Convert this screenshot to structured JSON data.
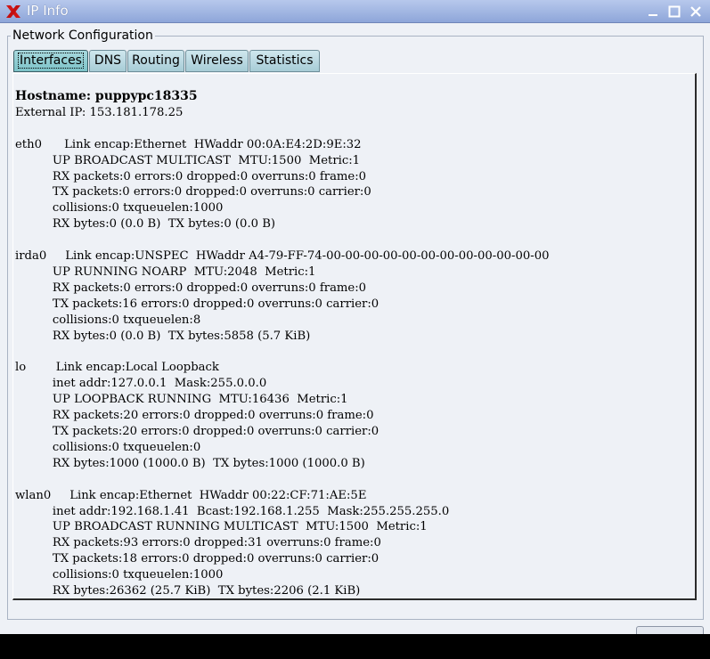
{
  "window": {
    "title": "IP Info",
    "controls": {
      "minimize": "minimize-icon",
      "maximize": "maximize-icon",
      "close": "close-icon"
    }
  },
  "frame": {
    "label": "Network Configuration"
  },
  "tabs": [
    {
      "label": "Interfaces",
      "active": true
    },
    {
      "label": "DNS",
      "active": false
    },
    {
      "label": "Routing",
      "active": false
    },
    {
      "label": "Wireless",
      "active": false
    },
    {
      "label": "Statistics",
      "active": false
    }
  ],
  "content": {
    "hostname_line": "Hostname: puppypc18335",
    "external_ip_line": "External IP: 153.181.178.25",
    "interfaces": [
      {
        "name": "eth0",
        "lines": [
          "Link encap:Ethernet  HWaddr 00:0A:E4:2D:9E:32",
          "UP BROADCAST MULTICAST  MTU:1500  Metric:1",
          "RX packets:0 errors:0 dropped:0 overruns:0 frame:0",
          "TX packets:0 errors:0 dropped:0 overruns:0 carrier:0",
          "collisions:0 txqueuelen:1000",
          "RX bytes:0 (0.0 B)  TX bytes:0 (0.0 B)"
        ]
      },
      {
        "name": "irda0",
        "lines": [
          "Link encap:UNSPEC  HWaddr A4-79-FF-74-00-00-00-00-00-00-00-00-00-00-00-00",
          "UP RUNNING NOARP  MTU:2048  Metric:1",
          "RX packets:0 errors:0 dropped:0 overruns:0 frame:0",
          "TX packets:16 errors:0 dropped:0 overruns:0 carrier:0",
          "collisions:0 txqueuelen:8",
          "RX bytes:0 (0.0 B)  TX bytes:5858 (5.7 KiB)"
        ]
      },
      {
        "name": "lo",
        "lines": [
          "Link encap:Local Loopback",
          "inet addr:127.0.0.1  Mask:255.0.0.0",
          "UP LOOPBACK RUNNING  MTU:16436  Metric:1",
          "RX packets:20 errors:0 dropped:0 overruns:0 frame:0",
          "TX packets:20 errors:0 dropped:0 overruns:0 carrier:0",
          "collisions:0 txqueuelen:0",
          "RX bytes:1000 (1000.0 B)  TX bytes:1000 (1000.0 B)"
        ]
      },
      {
        "name": "wlan0",
        "lines": [
          "Link encap:Ethernet  HWaddr 00:22:CF:71:AE:5E",
          "inet addr:192.168.1.41  Bcast:192.168.1.255  Mask:255.255.255.0",
          "UP BROADCAST RUNNING MULTICAST  MTU:1500  Metric:1",
          "RX packets:93 errors:0 dropped:31 overruns:0 frame:0",
          "TX packets:18 errors:0 dropped:0 overruns:0 carrier:0",
          "collisions:0 txqueuelen:1000",
          "RX bytes:26362 (25.7 KiB)  TX bytes:2206 (2.1 KiB)"
        ]
      }
    ]
  },
  "colors": {
    "titlebar": "#9fb5e3",
    "window_bg": "#eef1f6",
    "tab_bg": "#b8dbe3",
    "tab_active_bg": "#8fcdd2",
    "desktop": "#000000"
  }
}
